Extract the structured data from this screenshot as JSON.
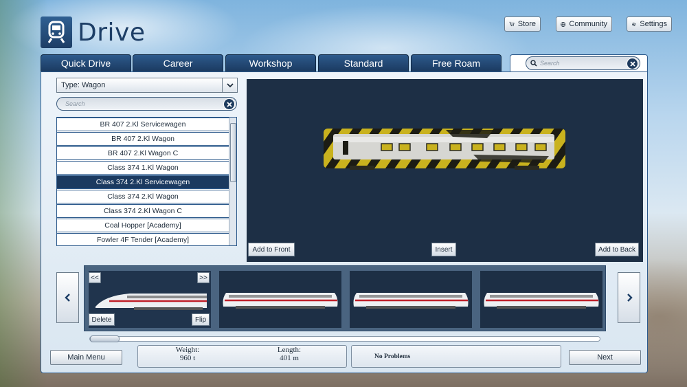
{
  "app": {
    "title": "Drive"
  },
  "top_buttons": {
    "store": "Store",
    "community": "Community",
    "settings": "Settings"
  },
  "tabs": [
    "Quick Drive",
    "Career",
    "Workshop",
    "Standard",
    "Free Roam"
  ],
  "global_search": {
    "placeholder": "Search"
  },
  "filter": {
    "type_label": "Type: Wagon",
    "search_placeholder": "Search"
  },
  "wagon_list": {
    "items": [
      "BR 407 2.Kl Servicewagen",
      "BR 407 2.Kl Wagon",
      "BR 407 2.Kl Wagon C",
      "Class 374 1.Kl Wagon",
      "Class 374 2.Kl Servicewagen",
      "Class 374 2.Kl Wagon",
      "Class 374 2.Kl Wagon C",
      "Coal Hopper [Academy]",
      "Fowler 4F Tender [Academy]"
    ],
    "selected_index": 4
  },
  "preview": {
    "add_front": "Add to Front",
    "insert": "Insert",
    "add_back": "Add to Back"
  },
  "consist": {
    "prev_label": "<<",
    "next_label": ">>",
    "delete": "Delete",
    "flip": "Flip"
  },
  "stats": {
    "weight_label": "Weight:",
    "weight_value": "960 t",
    "length_label": "Length:",
    "length_value": "401 m",
    "problems": "No Problems"
  },
  "footer": {
    "main_menu": "Main Menu",
    "next": "Next"
  },
  "colors": {
    "brand_dark": "#1b3a60",
    "accent": "#2d5a8c",
    "preview_bg": "#1d2f45"
  }
}
